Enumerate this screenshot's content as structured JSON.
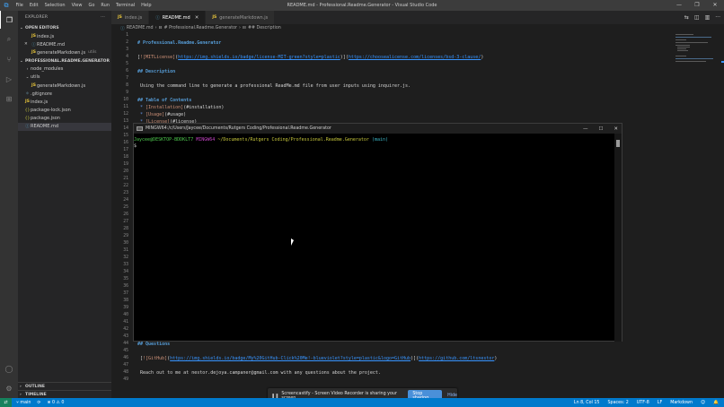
{
  "window": {
    "title": "README.md - Professional.Readme.Generator - Visual Studio Code",
    "menu": [
      "File",
      "Edit",
      "Selection",
      "View",
      "Go",
      "Run",
      "Terminal",
      "Help"
    ],
    "controls": [
      "—",
      "❐",
      "✕"
    ]
  },
  "activity_bar": {
    "icons": [
      "files-icon",
      "search-icon",
      "source-control-icon",
      "run-debug-icon",
      "extensions-icon",
      "account-icon",
      "settings-gear-icon"
    ]
  },
  "sidebar": {
    "title": "EXPLORER",
    "more": "···",
    "open_editors_label": "OPEN EDITORS",
    "open_editors": [
      {
        "icon": "JS",
        "name": "index.js",
        "desc": ""
      },
      {
        "icon": "ⓘ",
        "name": "README.md",
        "desc": "",
        "close": "✕"
      },
      {
        "icon": "JS",
        "name": "generateMarkdown.js",
        "desc": "utils"
      }
    ],
    "project_label": "PROFESSIONAL.README.GENERATOR",
    "tree": [
      {
        "icon": "›",
        "name": "node_modules",
        "indent": 1,
        "type": "folder-closed"
      },
      {
        "icon": "⌄",
        "name": "utils",
        "indent": 1,
        "type": "folder-open"
      },
      {
        "icon": "JS",
        "name": "generateMarkdown.js",
        "indent": 2,
        "type": "js"
      },
      {
        "icon": "◆",
        "name": ".gitignore",
        "indent": 1,
        "type": "git"
      },
      {
        "icon": "JS",
        "name": "index.js",
        "indent": 1,
        "type": "js"
      },
      {
        "icon": "{}",
        "name": "package-lock.json",
        "indent": 1,
        "type": "json"
      },
      {
        "icon": "{}",
        "name": "package.json",
        "indent": 1,
        "type": "json"
      },
      {
        "icon": "ⓘ",
        "name": "README.md",
        "indent": 1,
        "type": "md",
        "selected": true
      }
    ],
    "outline_label": "OUTLINE",
    "timeline_label": "TIMELINE"
  },
  "tabs": [
    {
      "icon": "JS",
      "label": "index.js",
      "active": false
    },
    {
      "icon": "ⓘ",
      "label": "README.md",
      "active": true,
      "close": "✕"
    },
    {
      "icon": "JS",
      "label": "generateMarkdown.js",
      "active": false
    }
  ],
  "breadcrumb": [
    "README.md",
    "# Professional.Readme.Generator",
    "## Description"
  ],
  "editor": {
    "lines": [
      {
        "n": "1",
        "text": "",
        "cls": "md-text"
      },
      {
        "n": "2",
        "text": "# Professional.Readme.Generator",
        "cls": "md-head"
      },
      {
        "n": "3",
        "text": "",
        "cls": "md-text"
      },
      {
        "n": "4",
        "parts": [
          {
            "t": "[",
            "c": "md-bracket"
          },
          {
            "t": "![MITLicense]",
            "c": "md-link"
          },
          {
            "t": "(",
            "c": "md-bracket"
          },
          {
            "t": "https://img.shields.io/badge/license-MIT-green?style=plastic",
            "c": "md-url"
          },
          {
            "t": ")](",
            "c": "md-bracket"
          },
          {
            "t": "https://choosealicense.com/licenses/bsd-3-clause/",
            "c": "md-url"
          },
          {
            "t": ")",
            "c": "md-bracket"
          }
        ]
      },
      {
        "n": "5",
        "text": "",
        "cls": "md-text"
      },
      {
        "n": "6",
        "text": "## Description",
        "cls": "md-head"
      },
      {
        "n": "7",
        "text": "",
        "cls": "md-text"
      },
      {
        "n": "8",
        "text": " Using the command line to generate a professional ReadMe.md file from user inputs using inquirer.js.",
        "cls": "md-text"
      },
      {
        "n": "9",
        "text": "",
        "cls": "md-text"
      },
      {
        "n": "10",
        "text": "## Table of Contents",
        "cls": "md-head"
      },
      {
        "n": "11",
        "parts": [
          {
            "t": " * ",
            "c": "md-list"
          },
          {
            "t": "[Installation]",
            "c": "md-link"
          },
          {
            "t": "(#installation)",
            "c": "md-text"
          }
        ]
      },
      {
        "n": "12",
        "parts": [
          {
            "t": " * ",
            "c": "md-list"
          },
          {
            "t": "[Usage]",
            "c": "md-link"
          },
          {
            "t": "(#usage)",
            "c": "md-text"
          }
        ]
      },
      {
        "n": "13",
        "parts": [
          {
            "t": " * ",
            "c": "md-list"
          },
          {
            "t": "[License]",
            "c": "md-link"
          },
          {
            "t": "(#license)",
            "c": "md-text"
          }
        ]
      },
      {
        "n": "14",
        "text": "",
        "cls": "md-text"
      },
      {
        "n": "15",
        "text": "",
        "cls": "md-text"
      },
      {
        "n": "16",
        "text": "",
        "cls": "md-text"
      },
      {
        "n": "17",
        "text": "",
        "cls": "md-text"
      },
      {
        "n": "18",
        "text": "",
        "cls": "md-text"
      },
      {
        "n": "19",
        "text": "",
        "cls": "md-text"
      },
      {
        "n": "20",
        "text": "",
        "cls": "md-text"
      },
      {
        "n": "21",
        "text": "",
        "cls": "md-text"
      },
      {
        "n": "22",
        "text": "",
        "cls": "md-text"
      },
      {
        "n": "23",
        "text": "",
        "cls": "md-text"
      },
      {
        "n": "24",
        "text": "",
        "cls": "md-text"
      },
      {
        "n": "25",
        "text": "",
        "cls": "md-text"
      },
      {
        "n": "26",
        "text": "",
        "cls": "md-text"
      },
      {
        "n": "27",
        "text": "",
        "cls": "md-text"
      },
      {
        "n": "28",
        "text": "",
        "cls": "md-text"
      },
      {
        "n": "29",
        "text": "",
        "cls": "md-text"
      },
      {
        "n": "30",
        "text": "",
        "cls": "md-text"
      },
      {
        "n": "31",
        "text": "",
        "cls": "md-text"
      },
      {
        "n": "32",
        "text": "",
        "cls": "md-text"
      },
      {
        "n": "33",
        "text": "",
        "cls": "md-text"
      },
      {
        "n": "34",
        "text": "",
        "cls": "md-text"
      },
      {
        "n": "35",
        "text": "",
        "cls": "md-text"
      },
      {
        "n": "36",
        "text": "",
        "cls": "md-text"
      },
      {
        "n": "37",
        "text": "",
        "cls": "md-text"
      },
      {
        "n": "38",
        "text": "",
        "cls": "md-text"
      },
      {
        "n": "39",
        "text": "",
        "cls": "md-text"
      },
      {
        "n": "40",
        "text": "",
        "cls": "md-text"
      },
      {
        "n": "41",
        "text": "",
        "cls": "md-text"
      },
      {
        "n": "42",
        "text": "",
        "cls": "md-text"
      },
      {
        "n": "43",
        "text": "",
        "cls": "md-text"
      },
      {
        "n": "44",
        "text": "## Questions",
        "cls": "md-head"
      },
      {
        "n": "45",
        "text": "",
        "cls": "md-text"
      },
      {
        "n": "46",
        "parts": [
          {
            "t": " [",
            "c": "md-bracket"
          },
          {
            "t": "![GitHub]",
            "c": "md-link"
          },
          {
            "t": "(",
            "c": "md-bracket"
          },
          {
            "t": "https://img.shields.io/badge/My%20GitHub-Click%20Me!-blueviolet?style=plastic&logo=GitHub",
            "c": "md-url"
          },
          {
            "t": ")](",
            "c": "md-bracket"
          },
          {
            "t": "https://github.com/ltsnestor",
            "c": "md-url"
          },
          {
            "t": ")",
            "c": "md-bracket"
          }
        ]
      },
      {
        "n": "47",
        "text": "",
        "cls": "md-text"
      },
      {
        "n": "48",
        "text": " Reach out to me at nestor.dejoya.campaner@gmail.com with any questions about the project.",
        "cls": "md-text"
      },
      {
        "n": "49",
        "text": "",
        "cls": "md-text"
      }
    ]
  },
  "terminal": {
    "title": "MINGW64:/c/Users/Jaycee/Documents/Rutgers Coding/Professional.Readme.Generator",
    "prompt_user": "Jaycee@DESKTOP-BDDKLT7",
    "prompt_sys": "MINGW64",
    "prompt_path": "~/Documents/Rutgers Coding/Professional.Readme.Generator",
    "prompt_branch": "(main)",
    "prompt_symbol": "$",
    "controls": [
      "—",
      "☐",
      "✕"
    ]
  },
  "banner": {
    "icon": "❚❚",
    "text": "Screencastify - Screen Video Recorder is sharing your screen.",
    "stop_label": "Stop sharing",
    "hide_label": "Hide"
  },
  "status_bar": {
    "remote_icon": "⇄",
    "branch": "main",
    "sync": "⟳",
    "problems": "⊗ 0 ⚠ 0",
    "position": "Ln 8, Col 15",
    "indent": "Spaces: 2",
    "encoding": "UTF-8",
    "eol": "LF",
    "language": "Markdown",
    "feedback_icon": "☺",
    "bell_icon": "🔔"
  },
  "colors": {
    "accent": "#007acc",
    "editor_bg": "#1e1e1e",
    "sidebar_bg": "#252526",
    "heading": "#569cd6",
    "link_text": "#ce9178"
  }
}
